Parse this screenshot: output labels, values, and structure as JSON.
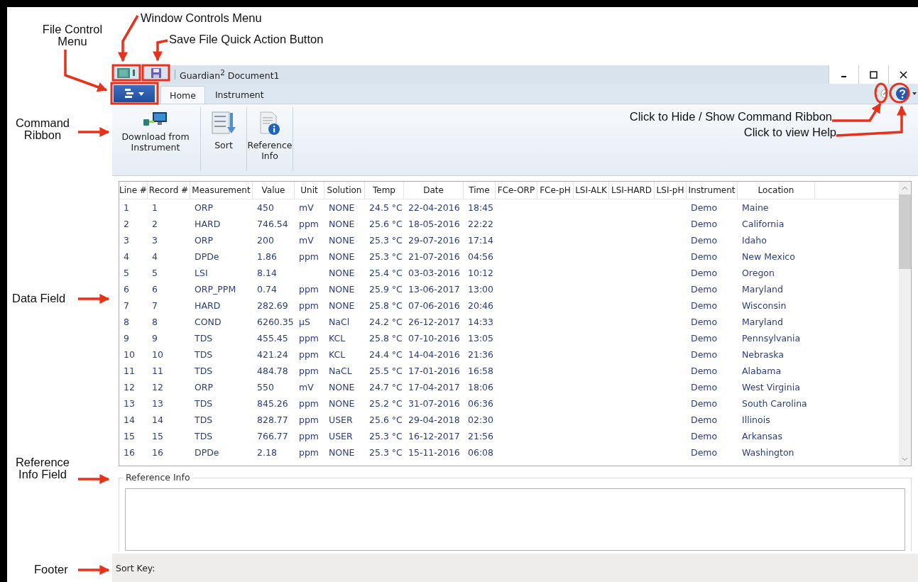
{
  "window": {
    "title": "Guardian$^{2}$ Document1"
  },
  "tabs": [
    {
      "label": "Home",
      "selected": true
    },
    {
      "label": "Instrument",
      "selected": false
    }
  ],
  "ribbon": {
    "buttons": [
      {
        "kind": "download",
        "label": "Download from Instrument"
      },
      {
        "kind": "sort",
        "label": "Sort"
      },
      {
        "kind": "reference",
        "label": "Reference Info"
      }
    ]
  },
  "table": {
    "columns": [
      "Line #",
      "Record #",
      "Measurement",
      "Value",
      "Unit",
      "Solution",
      "Temp",
      "Date",
      "Time",
      "FCe-ORP",
      "FCe-pH",
      "LSI-ALK",
      "LSI-HARD",
      "LSI-pH",
      "Instrument",
      "Location"
    ],
    "rows": [
      [
        "1",
        "1",
        "ORP",
        "450",
        "mV",
        "NONE",
        "24.5 °C",
        "22-04-2016",
        "18:45",
        null,
        null,
        null,
        null,
        null,
        "Demo",
        "Maine"
      ],
      [
        "2",
        "2",
        "HARD",
        "746.54",
        "ppm",
        "NONE",
        "25.6 °C",
        "18-05-2016",
        "22:22",
        null,
        null,
        null,
        null,
        null,
        "Demo",
        "California"
      ],
      [
        "3",
        "3",
        "ORP",
        "200",
        "mV",
        "NONE",
        "25.3 °C",
        "29-07-2016",
        "17:14",
        null,
        null,
        null,
        null,
        null,
        "Demo",
        "Idaho"
      ],
      [
        "4",
        "4",
        "DPDe",
        "1.86",
        "ppm",
        "NONE",
        "25.3 °C",
        "21-07-2016",
        "04:56",
        null,
        null,
        null,
        null,
        null,
        "Demo",
        "New Mexico"
      ],
      [
        "5",
        "5",
        "LSI",
        "8.14",
        null,
        "NONE",
        "25.4 °C",
        "03-03-2016",
        "10:12",
        null,
        null,
        null,
        null,
        null,
        "Demo",
        "Oregon"
      ],
      [
        "6",
        "6",
        "ORP_PPM",
        "0.74",
        "ppm",
        "NONE",
        "25.9 °C",
        "13-06-2017",
        "13:00",
        null,
        null,
        null,
        null,
        null,
        "Demo",
        "Maryland"
      ],
      [
        "7",
        "7",
        "HARD",
        "282.69",
        "ppm",
        "NONE",
        "25.8 °C",
        "07-06-2016",
        "20:46",
        null,
        null,
        null,
        null,
        null,
        "Demo",
        "Wisconsin"
      ],
      [
        "8",
        "8",
        "COND",
        "6260.35",
        "µS",
        "NaCl",
        "24.2 °C",
        "26-12-2017",
        "14:33",
        null,
        null,
        null,
        null,
        null,
        "Demo",
        "Maryland"
      ],
      [
        "9",
        "9",
        "TDS",
        "455.45",
        "ppm",
        "KCL",
        "25.8 °C",
        "07-10-2016",
        "13:05",
        null,
        null,
        null,
        null,
        null,
        "Demo",
        "Pennsylvania"
      ],
      [
        "10",
        "10",
        "TDS",
        "421.24",
        "ppm",
        "KCL",
        "24.4 °C",
        "14-04-2016",
        "21:36",
        null,
        null,
        null,
        null,
        null,
        "Demo",
        "Nebraska"
      ],
      [
        "11",
        "11",
        "TDS",
        "484.78",
        "ppm",
        "NaCL",
        "25.5 °C",
        "17-01-2016",
        "16:58",
        null,
        null,
        null,
        null,
        null,
        "Demo",
        "Alabama"
      ],
      [
        "12",
        "12",
        "ORP",
        "550",
        "mV",
        "NONE",
        "24.7 °C",
        "17-04-2017",
        "18:06",
        null,
        null,
        null,
        null,
        null,
        "Demo",
        "West Virginia"
      ],
      [
        "13",
        "13",
        "TDS",
        "845.26",
        "ppm",
        "NONE",
        "25.2 °C",
        "31-07-2016",
        "06:36",
        null,
        null,
        null,
        null,
        null,
        "Demo",
        "South Carolina"
      ],
      [
        "14",
        "14",
        "TDS",
        "828.77",
        "ppm",
        "USER",
        "25.6 °C",
        "29-04-2018",
        "02:30",
        null,
        null,
        null,
        null,
        null,
        "Demo",
        "Illinois"
      ],
      [
        "15",
        "15",
        "TDS",
        "766.77",
        "ppm",
        "USER",
        "25.3 °C",
        "16-12-2017",
        "21:56",
        null,
        null,
        null,
        null,
        null,
        "Demo",
        "Arkansas"
      ],
      [
        "16",
        "16",
        "DPDe",
        "2.18",
        "ppm",
        "NONE",
        "25.3 °C",
        "15-11-2016",
        "06:08",
        null,
        null,
        null,
        null,
        null,
        "Demo",
        "Washington"
      ]
    ]
  },
  "reference_info": {
    "label": "Reference Info"
  },
  "status_bar": {
    "label": "Sort Key:"
  },
  "annotations": [
    {
      "text": "Window Controls Menu"
    },
    {
      "text": "File Control Menu"
    },
    {
      "text": "Save File Quick Action Button"
    },
    {
      "text": "Command Ribbon"
    },
    {
      "text": "Click to Hide / Show Command Ribbon"
    },
    {
      "text": "Click to view Help"
    },
    {
      "text": "Data Field"
    },
    {
      "text": "Reference Info Field"
    },
    {
      "text": "Footer"
    }
  ]
}
